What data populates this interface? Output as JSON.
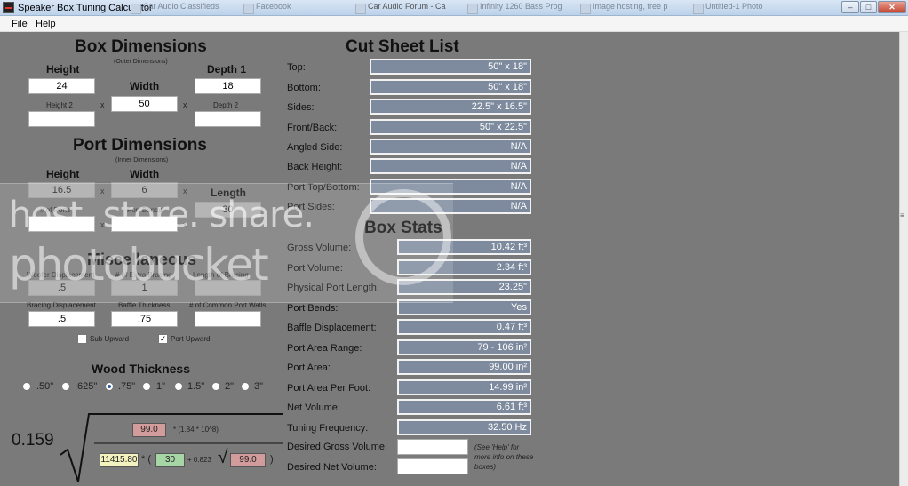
{
  "window": {
    "title": "Speaker Box Tuning Calculator",
    "background_tabs": [
      "Car Audio Classifieds",
      "Facebook",
      "Car Audio Forum - Ca",
      "Infinity 1260 Bass Prog",
      "Image hosting, free p",
      "Untitled-1 Photo"
    ],
    "controls": {
      "minimize": "–",
      "maximize": "□",
      "close": "✕"
    }
  },
  "menu": [
    "File",
    "Help"
  ],
  "box_dimensions": {
    "title": "Box Dimensions",
    "subtitle": "(Outer Dimensions)",
    "height_label": "Height",
    "width_label": "Width",
    "depth1_label": "Depth 1",
    "height2_label": "Height 2",
    "depth2_label": "Depth 2",
    "height": "24",
    "width": "50",
    "depth1": "18",
    "height2": "",
    "depth2": "",
    "x": "x"
  },
  "port_dimensions": {
    "title": "Port Dimensions",
    "subtitle": "(Inner Dimensions)",
    "height_label": "Height",
    "width_label": "Width",
    "length_label": "Length",
    "height": "16.5",
    "width": "6",
    "length": "30",
    "ports_label": "# of Ports",
    "bends_label": "Port Bends",
    "ports": "",
    "bends": ""
  },
  "misc": {
    "title": "Miscellaneous",
    "woofer_label": "Woofer Displacement",
    "bracing_count_label": "# of Extra Bracing",
    "length_label": "Length of Bracing",
    "woofer_disp": ".5",
    "bracing_count": "1",
    "bracing_length": "",
    "bracing_disp_label": "Bracing Displacement",
    "baffle_label": "Baffle Thickness",
    "common_walls_label": "# of Common Port Walls",
    "bracing_disp": ".5",
    "baffle": ".75",
    "common_walls": "",
    "sub_upward_label": "Sub Upward",
    "port_upward_label": "Port Upward",
    "sub_upward": false,
    "port_upward": true,
    "check": "✓"
  },
  "wood": {
    "title": "Wood Thickness",
    "options": [
      ".50\"",
      ".625\"",
      ".75\"",
      "1\"",
      "1.5\"",
      "2\"",
      "3\""
    ],
    "selected_index": 2
  },
  "formula": {
    "coef": "0.159",
    "num_val": "99.0",
    "num_tail": "* (1.84 * 10^8)",
    "d_val": "11415.80",
    "d_mid": "* (",
    "d_box2": "30",
    "d_plus": "+ 0.823",
    "d_box3": "99.0",
    "d_close": ")",
    "radical": "√"
  },
  "cut_sheet": {
    "title": "Cut Sheet List",
    "rows": [
      {
        "label": "Top:",
        "value": "50\" x 18\""
      },
      {
        "label": "Bottom:",
        "value": "50\" x 18\""
      },
      {
        "label": "Sides:",
        "value": "22.5\" x 16.5\""
      },
      {
        "label": "Front/Back:",
        "value": "50\" x 22.5\""
      },
      {
        "label": "Angled Side:",
        "value": "N/A"
      },
      {
        "label": "Back Height:",
        "value": "N/A"
      },
      {
        "label": "Port Top/Bottom:",
        "value": "N/A"
      },
      {
        "label": "Port Sides:",
        "value": "N/A"
      }
    ]
  },
  "box_stats": {
    "title": "Box Stats",
    "rows": [
      {
        "label": "Gross Volume:",
        "value": "10.42 ft³"
      },
      {
        "label": "Port Volume:",
        "value": "2.34 ft³"
      },
      {
        "label": "Physical Port Length:",
        "value": "23.25\""
      },
      {
        "label": "Port Bends:",
        "value": "Yes"
      },
      {
        "label": "Baffle Displacement:",
        "value": "0.47 ft³"
      },
      {
        "label": "Port Area Range:",
        "value": "79 - 106 in²"
      },
      {
        "label": "Port Area:",
        "value": "99.00 in²"
      },
      {
        "label": "Port Area Per Foot:",
        "value": "14.99 in²"
      },
      {
        "label": "Net Volume:",
        "value": "6.61 ft³"
      },
      {
        "label": "Tuning Frequency:",
        "value": "32.50 Hz"
      }
    ],
    "desired_gross_label": "Desired Gross Volume:",
    "desired_net_label": "Desired Net Volume:",
    "desired_gross": "",
    "desired_net": "",
    "help_note": "(See 'Help' for more info on these boxes)"
  },
  "watermark": {
    "line1": "host. store. share.",
    "line2": "photobucket"
  }
}
